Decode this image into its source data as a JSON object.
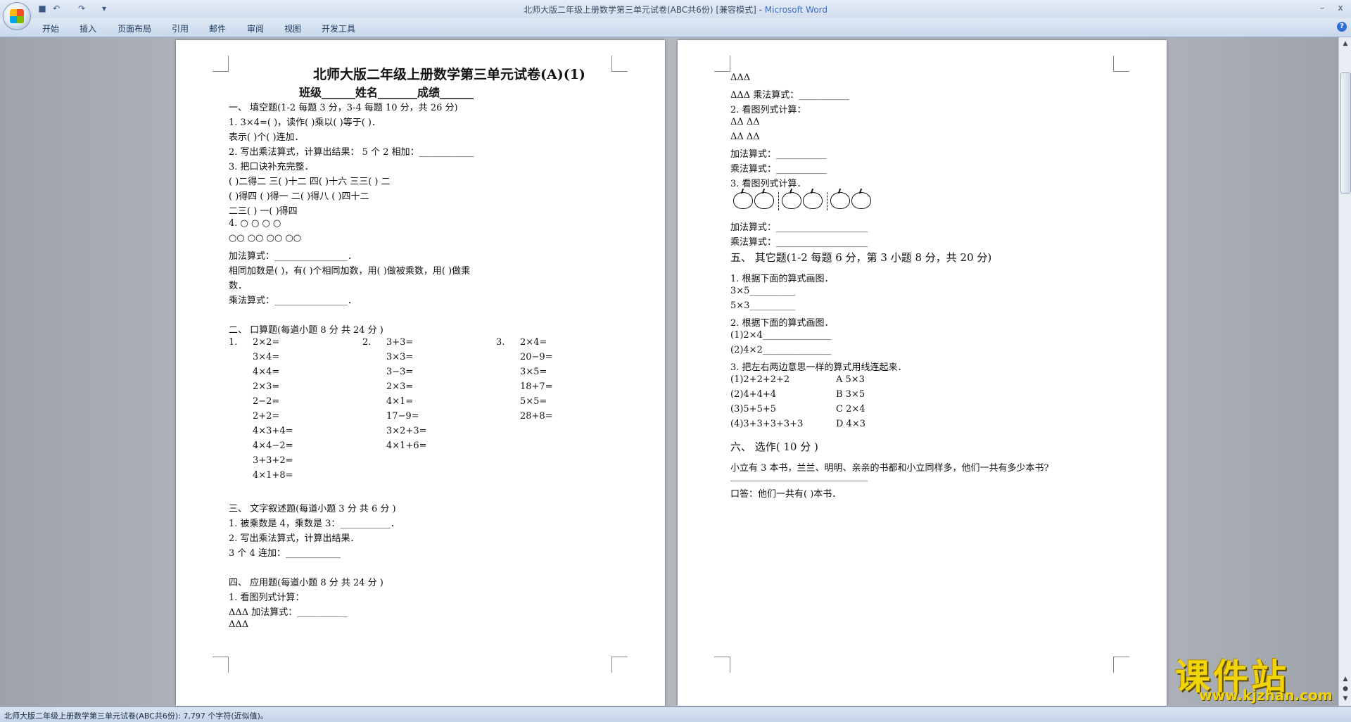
{
  "window": {
    "title": "北师大版二年级上册数学第三单元试卷(ABC共6份) [兼容模式]",
    "app_name": "Microsoft Word",
    "minimize": "–",
    "close": "x"
  },
  "quick_access": {
    "undo": "↶",
    "redo": "↷",
    "more": "▾"
  },
  "ribbon_tabs": [
    "开始",
    "插入",
    "页面布局",
    "引用",
    "邮件",
    "审阅",
    "视图",
    "开发工具"
  ],
  "help": "?",
  "page1": {
    "title": "北师大版二年级上册数学第三单元试卷(A)(1)",
    "subtitle": "班级______姓名_______成绩______",
    "s1_heading": "一、  填空题(1-2 每题 3 分，3-4 每题  10 分，共  26 分)",
    "q1a": "1. 3×4=(          )，读作(          )乘以(          )等于(          )．",
    "q1b": "表示(          )个(          )连加．",
    "q2": "2. 写出乘法算式，计算出结果：   5 个 2 相加：____________",
    "q3": "3. 把口诀补充完整．",
    "q3_row1": "(          )二得二      三(          )十二          四(          )十六        三三(          )        二",
    "q3_row2": "(          )得四          (          )得一                二(          )得八            (          )四十二",
    "q3_row3": "二三(          )              一(          )得四",
    "q4_row1": "4.    ○         ○                    ○                                 ○",
    "q4_row2": "      ○○      ○○          ○○          ○○",
    "add_formula": "加法算式：________________．",
    "same_addend": "相同加数是(          )，有(          )个相同加数，用(          )做被乘数，用(          )做乘",
    "same_addend2": "数．",
    "mul_formula": "乘法算式：________________．",
    "s2_heading": "二、  口算题(每道小题  8 分 共  24 分 )",
    "col1_label": "1.",
    "col2_label": "2.",
    "col3_label": "3.",
    "col1": [
      "2×2=",
      "3×4=",
      "4×4=",
      "2×3=",
      "2−2=",
      "2+2=",
      "4×3+4=",
      "4×4−2=",
      "3+3+2=",
      "4×1+8="
    ],
    "col2": [
      "3+3=",
      "3×3=",
      "3−3=",
      "2×3=",
      "4×1=",
      "17−9=",
      "3×2+3=",
      "4×1+6="
    ],
    "col3": [
      "2×4=",
      "20−9=",
      "3×5=",
      "18+7=",
      "5×5=",
      "28+8="
    ],
    "s3_heading": "三、  文字叙述题(每道小题  3 分 共  6 分 )",
    "s3_q1": "1. 被乘数是 4，乘数是 3：___________．",
    "s3_q2": "2. 写出乘法算式，计算出结果．",
    "s3_q2b": "3 个 4 连加：____________",
    "s4_heading": "四、  应用题(每道小题  8 分 共  24 分 )",
    "s4_q1": "1. 看图列式计算：",
    "s4_l1": "ΔΔΔ 加法算式：___________",
    "s4_l2": "ΔΔΔ"
  },
  "page2": {
    "l1": "ΔΔΔ",
    "l2": "ΔΔΔ 乘法算式：___________",
    "l3": "2. 看图列式计算：",
    "l4": "ΔΔ      ΔΔ",
    "l5": "ΔΔ      ΔΔ",
    "l6": "加法算式：___________",
    "l7": "乘法算式：___________",
    "l8": "3. 看图列式计算．",
    "l9": "加法算式：____________________",
    "l10": "乘法算式：____________________",
    "s5_heading": "五、  其它题(1-2 每题  6 分，第 3 小题  8 分，共  20 分)",
    "s5_q1": "1. 根据下面的算式画图．",
    "s5_q1a": "3×5__________",
    "s5_q1b": "5×3__________",
    "s5_q2": "2. 根据下面的算式画图．",
    "s5_q2a": "(1)2×4_______________",
    "s5_q2b": "(2)4×2_______________",
    "s5_q3": "3. 把左右两边意思一样的算式用线连起来．",
    "match_left": [
      "(1)2+2+2+2",
      "(2)4+4+4",
      "(3)5+5+5",
      "(4)3+3+3+3+3"
    ],
    "match_right": [
      "A 5×3",
      "B 3×5",
      "C 2×4",
      "D 4×3"
    ],
    "s6_heading": "六、  选作( 10 分 )",
    "s6_q": "小立有 3 本书，兰兰、明明、亲亲的书都和小立同样多，他们一共有多少本书?",
    "s6_blank": "______________________________",
    "s6_ans": "口答：他们一共有(          )本书．"
  },
  "status_text": "北师大版二年级上册数学第三单元试卷(ABC共6份): 7,797 个字符(近似值)。",
  "watermark": {
    "cn": "课件站",
    "url": "www.kjzhan.com"
  },
  "colors": {
    "accent": "#3d6cc0",
    "watermark": "#f2d40a"
  }
}
